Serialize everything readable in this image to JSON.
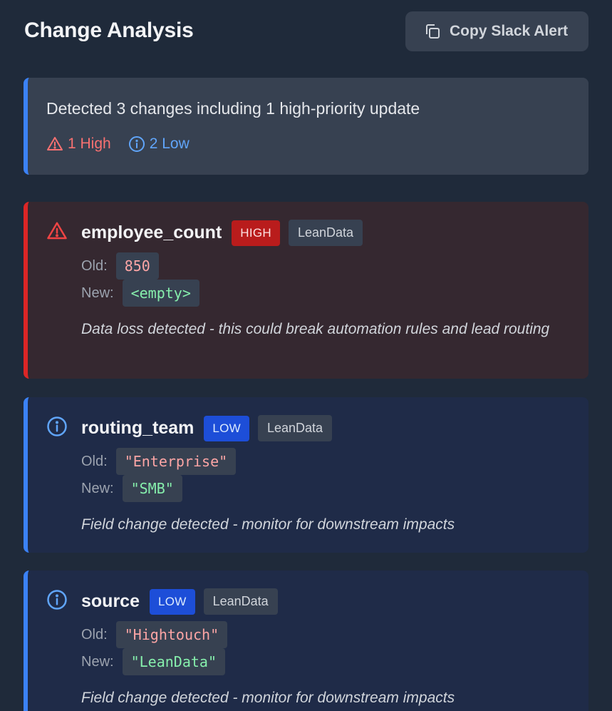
{
  "header": {
    "title": "Change Analysis",
    "copy_button_label": "Copy Slack Alert"
  },
  "summary": {
    "text": "Detected 3 changes including 1 high-priority update",
    "high_count": "1 High",
    "low_count": "2 Low"
  },
  "labels": {
    "old": "Old:",
    "new": "New:"
  },
  "changes": [
    {
      "field": "employee_count",
      "priority": "HIGH",
      "source": "LeanData",
      "old_value": "850",
      "new_value": "<empty>",
      "note": "Data loss detected - this could break automation rules and lead routing"
    },
    {
      "field": "routing_team",
      "priority": "LOW",
      "source": "LeanData",
      "old_value": "\"Enterprise\"",
      "new_value": "\"SMB\"",
      "note": "Field change detected - monitor for downstream impacts"
    },
    {
      "field": "source",
      "priority": "LOW",
      "source": "LeanData",
      "old_value": "\"Hightouch\"",
      "new_value": "\"LeanData\"",
      "note": "Field change detected - monitor for downstream impacts"
    }
  ],
  "colors": {
    "background": "#1f2a3a",
    "high": "#dc2626",
    "low": "#3b82f6"
  },
  "icons": {
    "copy": "copy-icon",
    "high": "warning-triangle-icon",
    "low": "info-circle-icon"
  }
}
